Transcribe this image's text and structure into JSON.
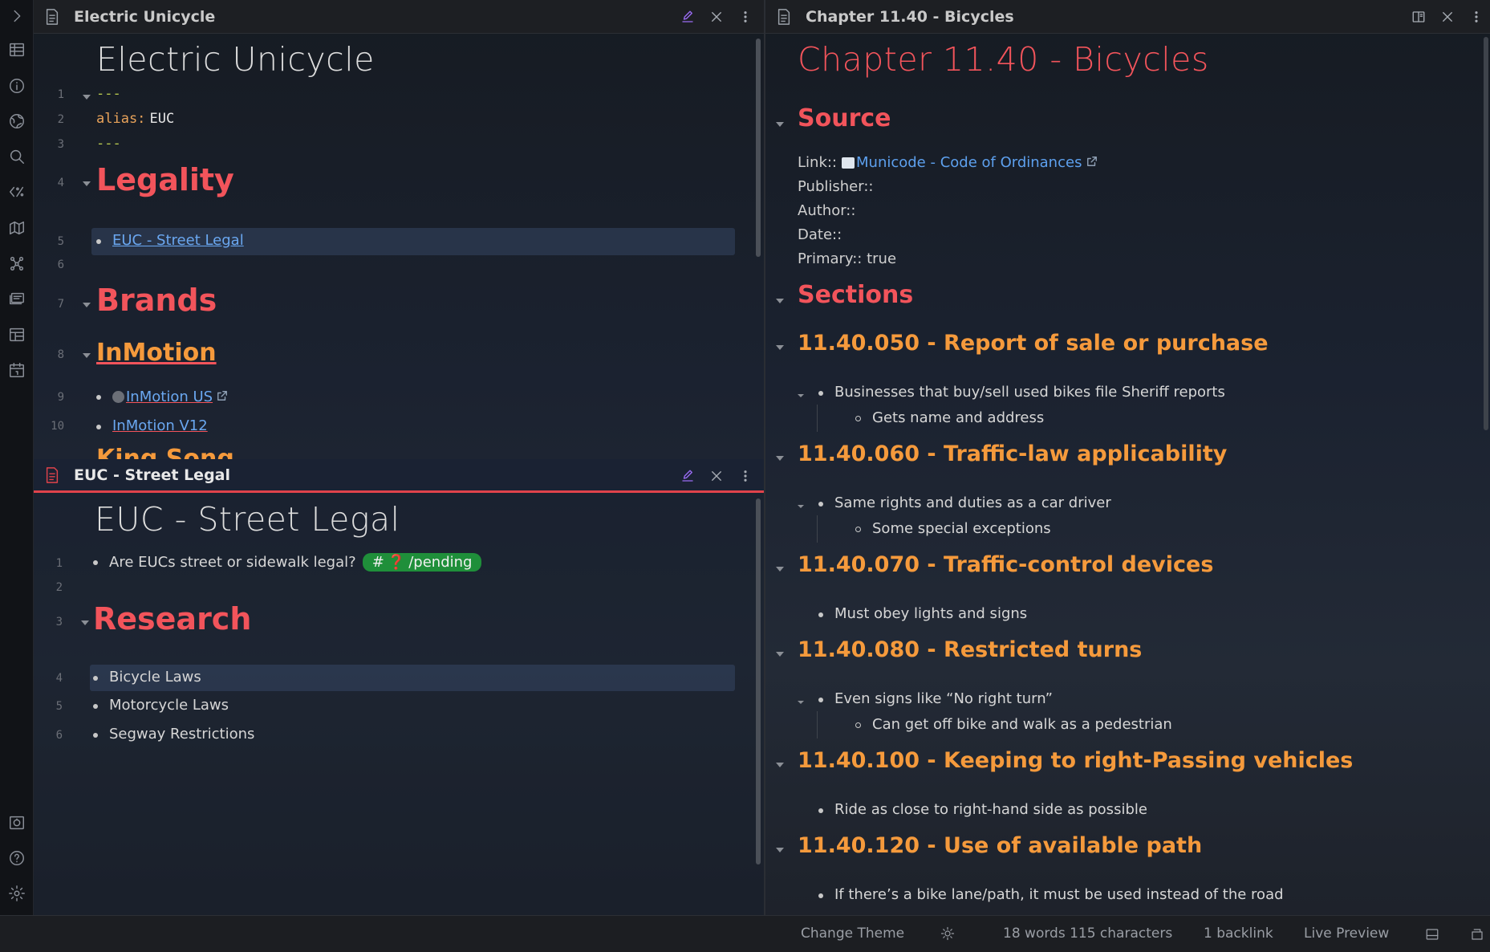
{
  "left_top_pane": {
    "title": "Electric Unicycle",
    "inline_title": "Electric Unicycle",
    "lines": {
      "l1": "1",
      "l2": "2",
      "l3": "3",
      "l4": "4",
      "l5": "5",
      "l6": "6",
      "l7": "7",
      "l8": "8",
      "l9": "9",
      "l10": "10"
    },
    "frontmatter_open": "---",
    "frontmatter_key": "alias:",
    "frontmatter_value": "EUC",
    "frontmatter_close": "---",
    "heading_legality": "Legality",
    "link_street_legal": "EUC - Street Legal",
    "heading_brands": "Brands",
    "heading_inmotion": "InMotion",
    "link_inmotion_us": "InMotion US",
    "link_inmotion_v12": "InMotion V12",
    "partial_next": "King Song"
  },
  "left_bottom_pane": {
    "title": "EUC - Street Legal",
    "inline_title": "EUC - Street Legal",
    "lines": {
      "l1": "1",
      "l2": "2",
      "l3": "3",
      "l4": "4",
      "l5": "5",
      "l6": "6"
    },
    "question": "Are EUCs street or sidewalk legal?",
    "tag_hash": "#",
    "tag_emoji": "❓",
    "tag_text": "/pending",
    "heading_research": "Research",
    "items": [
      "Bicycle Laws",
      "Motorcycle Laws",
      "Segway Restrictions"
    ]
  },
  "right_pane": {
    "title": "Chapter 11.40 - Bicycles",
    "inline_title": "Chapter 11.40 - Bicycles",
    "heading_source": "Source",
    "props": {
      "link_label": "Link::",
      "link_text": "Municode - Code of Ordinances",
      "publisher": "Publisher::",
      "author": "Author::",
      "date": "Date::",
      "primary": "Primary:: true"
    },
    "heading_sections": "Sections",
    "sections": [
      {
        "title": "11.40.050 - Report of sale or purchase",
        "bullet": "Businesses that buy/sell used bikes file Sheriff reports",
        "sub": "Gets name and address"
      },
      {
        "title": "11.40.060 - Traffic-law applicability",
        "bullet": "Same rights and duties as a car driver",
        "sub": "Some special exceptions"
      },
      {
        "title": "11.40.070 - Traffic-control devices",
        "bullet": "Must obey lights and signs"
      },
      {
        "title": "11.40.080 - Restricted turns",
        "bullet": "Even signs like “No right turn”",
        "sub": "Can get off bike and walk as a pedestrian"
      },
      {
        "title": "11.40.100 - Keeping to right-Passing vehicles",
        "bullet": "Ride as close to right-hand side as possible"
      },
      {
        "title": "11.40.120 - Use of available path",
        "bullet": "If there’s a bike lane/path, it must be used instead of the road"
      }
    ]
  },
  "statusbar": {
    "change_theme": "Change Theme",
    "counts": "18 words 115 characters",
    "backlinks": "1 backlink",
    "mode": "Live Preview"
  },
  "colors": {
    "heading_red": "#f2545b",
    "heading_orange": "#f59a3c",
    "link_blue": "#6aa7f0",
    "tag_green": "#1f8f3a",
    "active_pane_border": "#e0434b"
  }
}
